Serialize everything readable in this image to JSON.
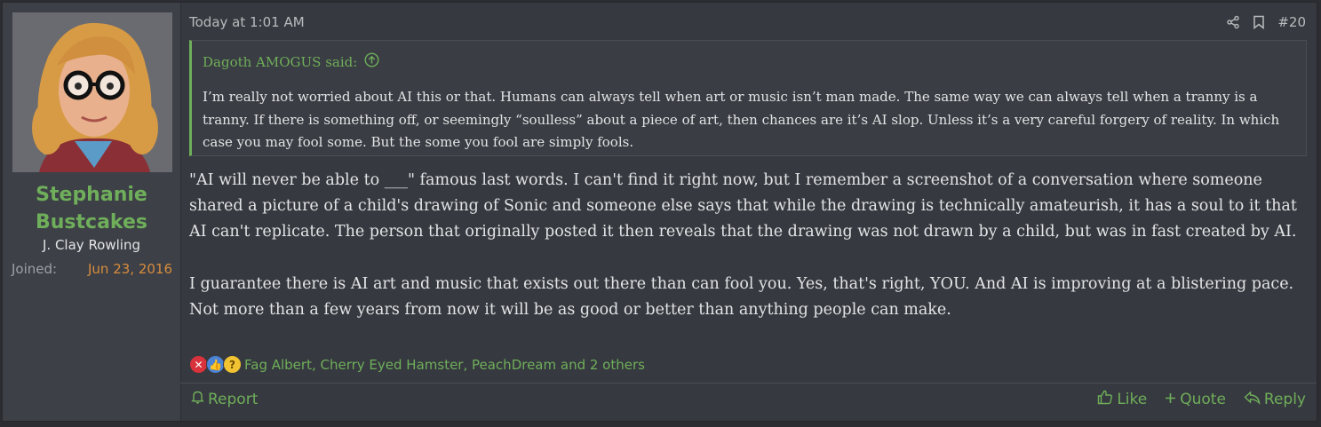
{
  "user": {
    "name_line1": "Stephanie",
    "name_line2": "Bustcakes",
    "title": "J. Clay Rowling",
    "joined_label": "Joined:",
    "joined_date": "Jun 23, 2016"
  },
  "post": {
    "date": "Today at 1:01 AM",
    "number": "#20",
    "icons": [
      "share-icon",
      "bookmark-icon"
    ]
  },
  "quote": {
    "author_said": "Dagoth AMOGUS said:",
    "text": "I’m really not worried about AI this or that. Humans can always tell when art or music isn’t man made. The same way we can always tell when a tranny is a tranny. If there is something off, or seemingly “soulless” about a piece of art, then chances are it’s AI slop. Unless it’s a very careful forgery of reality. In which case you may fool some. But the some you fool are simply fools."
  },
  "message": {
    "paragraph1": "\"AI will never be able to ___\" famous last words. I can't find it right now, but I remember a screenshot of a conversation where someone shared a picture of a child's drawing of Sonic and someone else says that while the drawing is technically amateurish, it has a soul to it that AI can't replicate. The person that originally posted it then reveals that the drawing was not drawn by a child, but was in fast created by AI.",
    "paragraph2": "I guarantee there is AI art and music that exists out there than can fool you. Yes, that's right, YOU. And AI is improving at a blistering pace. Not more than a few years from now it will be as good or better than anything people can make."
  },
  "reactions": {
    "text": "Fag Albert, Cherry Eyed Hamster, PeachDream and 2 others",
    "icons": [
      "dislike-x-icon",
      "thumbs-up-icon",
      "thinking-face-icon"
    ]
  },
  "footer": {
    "report": "Report",
    "like": "Like",
    "quote": "Quote",
    "reply": "Reply"
  },
  "colors": {
    "accent": "#6fae5a",
    "joined_date": "#d98c3e",
    "background": "#36393f"
  }
}
